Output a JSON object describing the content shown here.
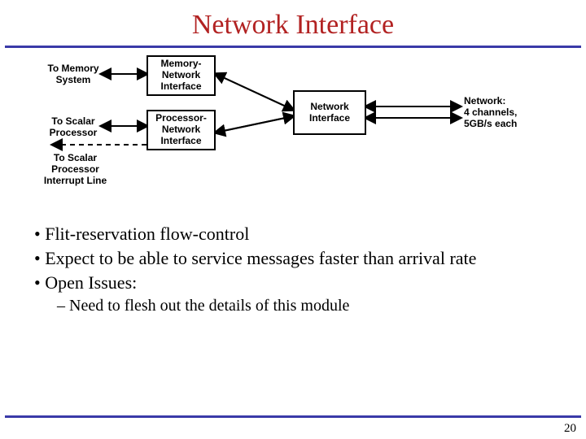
{
  "title": "Network Interface",
  "diagram": {
    "labels": {
      "to_memory": "To Memory\nSystem",
      "to_scalar": "To Scalar\nProcessor",
      "to_irq": "To Scalar\nProcessor\nInterrupt Line",
      "network_info": "Network:\n4 channels,\n5GB/s each"
    },
    "boxes": {
      "mni": "Memory-\nNetwork\nInterface",
      "pni": "Processor-\nNetwork\nInterface",
      "ni": "Network\nInterface"
    }
  },
  "bullets": [
    "Flit-reservation flow-control",
    "Expect to be able to service messages faster than arrival rate",
    "Open Issues:"
  ],
  "subbullets": [
    "Need to flesh out the details of this module"
  ],
  "page_number": "20"
}
